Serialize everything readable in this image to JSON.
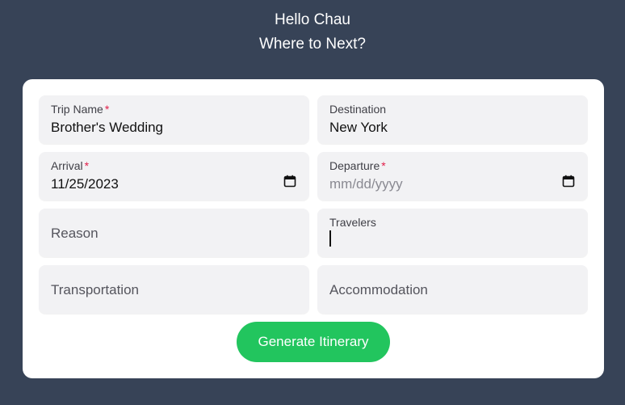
{
  "header": {
    "greeting": "Hello Chau",
    "subtitle": "Where to Next?"
  },
  "form": {
    "trip_name": {
      "label": "Trip Name",
      "required": "*",
      "value": "Brother's Wedding"
    },
    "destination": {
      "label": "Destination",
      "value": "New York"
    },
    "arrival": {
      "label": "Arrival",
      "required": "*",
      "value": "11/25/2023",
      "icon": "calendar-icon"
    },
    "departure": {
      "label": "Departure",
      "required": "*",
      "placeholder": "mm/dd/yyyy",
      "icon": "calendar-icon"
    },
    "reason": {
      "placeholder": "Reason"
    },
    "travelers": {
      "label": "Travelers",
      "value": ""
    },
    "transportation": {
      "placeholder": "Transportation"
    },
    "accommodation": {
      "placeholder": "Accommodation"
    },
    "submit_label": "Generate Itinerary"
  },
  "colors": {
    "background": "#374357",
    "card": "#ffffff",
    "field": "#f2f2f4",
    "required": "#e11d48",
    "button": "#22c55e"
  }
}
